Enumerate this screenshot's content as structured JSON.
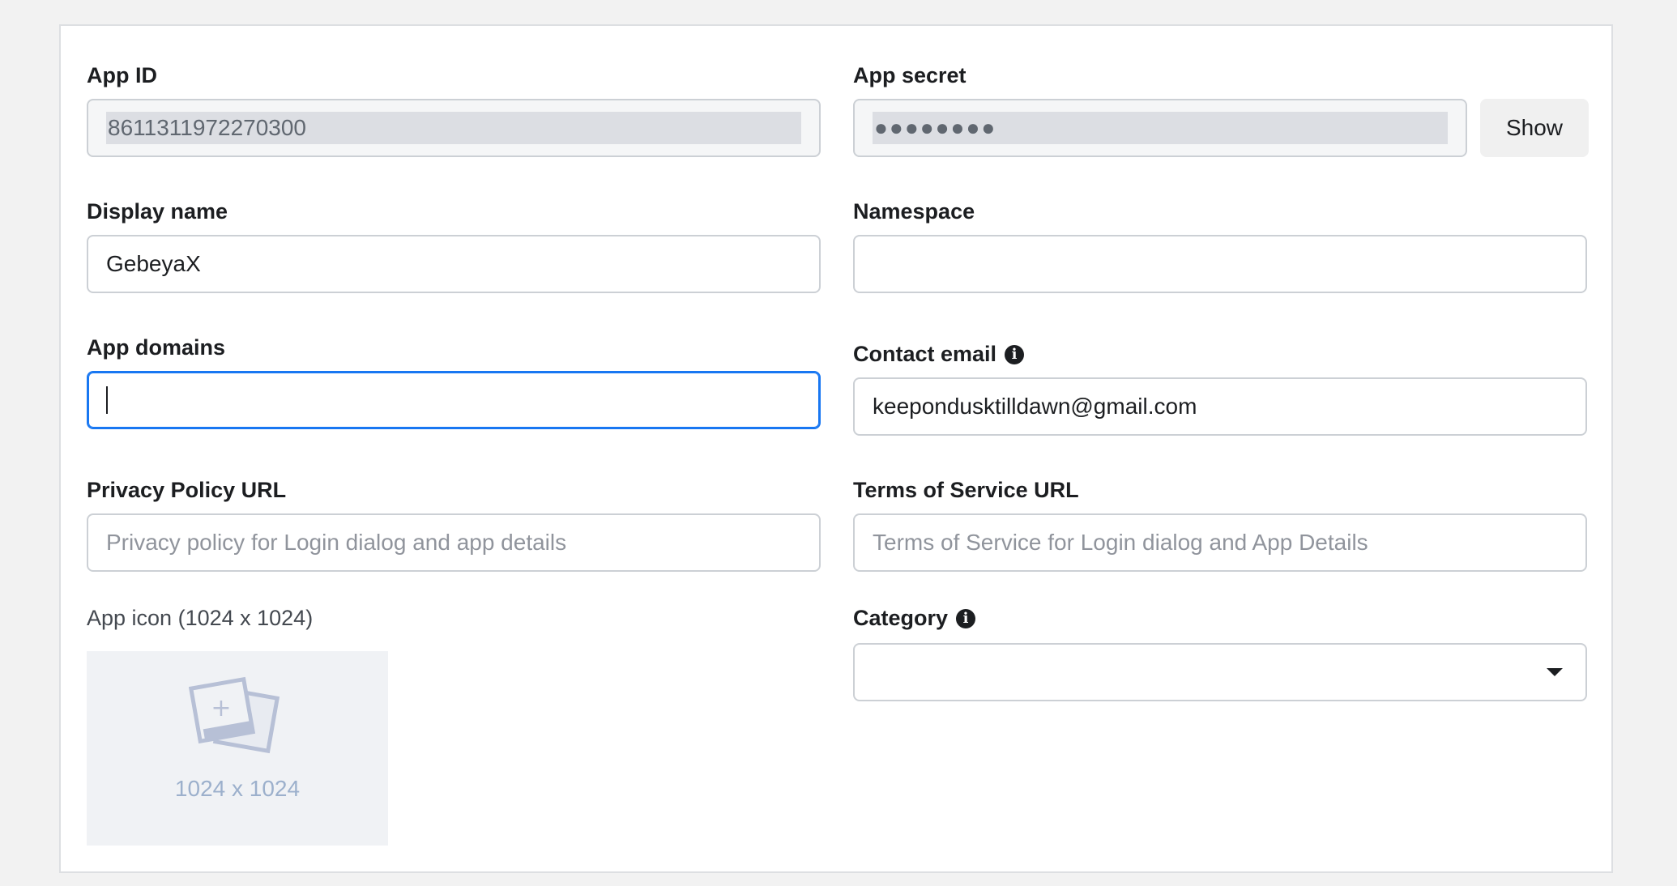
{
  "app_id": {
    "label": "App ID",
    "value": "8611311972270300"
  },
  "app_secret": {
    "label": "App secret",
    "value": "●●●●●●●●",
    "show_button": "Show"
  },
  "display_name": {
    "label": "Display name",
    "value": "GebeyaX"
  },
  "namespace": {
    "label": "Namespace",
    "value": ""
  },
  "app_domains": {
    "label": "App domains",
    "value": ""
  },
  "contact_email": {
    "label": "Contact email",
    "value": "keepondusktilldawn@gmail.com",
    "info_icon": "info-icon"
  },
  "privacy_policy": {
    "label": "Privacy Policy URL",
    "placeholder": "Privacy policy for Login dialog and app details"
  },
  "terms_of_service": {
    "label": "Terms of Service URL",
    "placeholder": "Terms of Service for Login dialog and App Details"
  },
  "app_icon": {
    "label": "App icon (1024 x 1024)",
    "size_text": "1024 x 1024",
    "icon": "add-photo-icon"
  },
  "category": {
    "label": "Category",
    "value": "",
    "info_icon": "info-icon",
    "arrow_icon": "chevron-down-icon"
  },
  "colors": {
    "focus": "#1877f2",
    "border": "#ccd0d5",
    "placeholder_icon": "#9cb0cc"
  }
}
